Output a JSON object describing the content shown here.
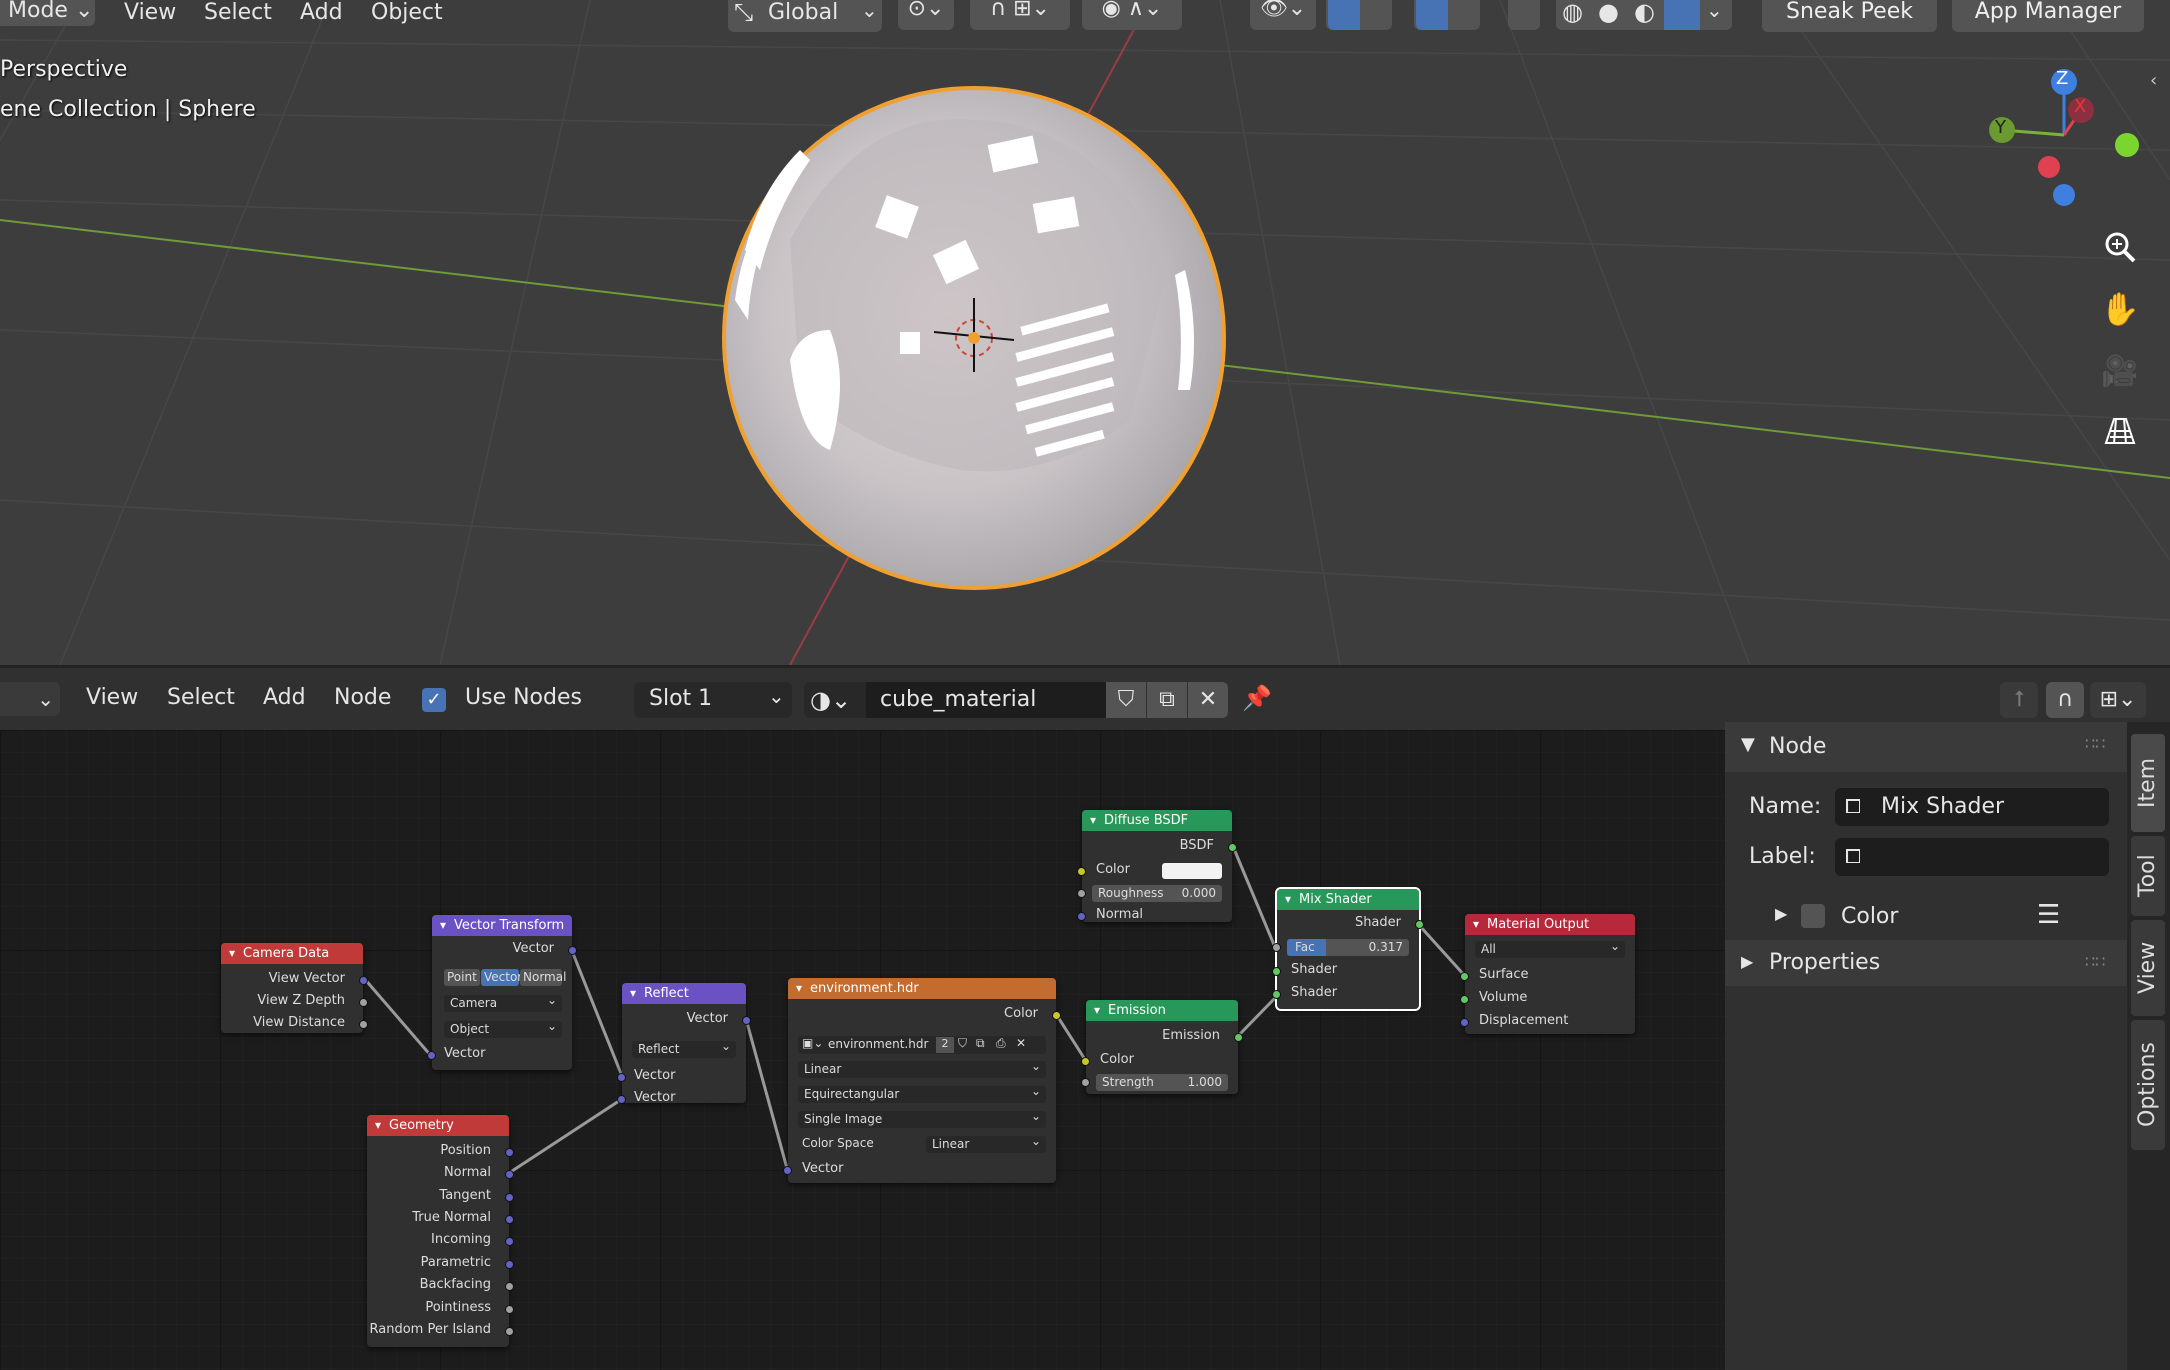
{
  "viewport": {
    "menu": [
      "Mode",
      "View",
      "Select",
      "Add",
      "Object"
    ],
    "transform_orientation": "Global",
    "buttons": [
      "Sneak Peek",
      "App Manager"
    ],
    "overlay_line1": "Perspective",
    "overlay_line2": "ene Collection | Sphere",
    "gizmo": {
      "z": "Z",
      "x": "X",
      "y": "Y"
    }
  },
  "node_editor_header": {
    "menu": [
      "View",
      "Select",
      "Add",
      "Node"
    ],
    "use_nodes_label": "Use Nodes",
    "slot": "Slot 1",
    "material": "cube_material"
  },
  "nodes": {
    "camera_data": {
      "title": "Camera Data",
      "outputs": [
        "View Vector",
        "View Z Depth",
        "View Distance"
      ]
    },
    "vector_transform": {
      "title": "Vector Transform",
      "output": "Vector",
      "modes": [
        "Point",
        "Vector",
        "Normal"
      ],
      "from": "Camera",
      "to": "Object",
      "input": "Vector"
    },
    "reflect": {
      "title": "Reflect",
      "output": "Vector",
      "op": "Reflect",
      "inputs": [
        "Vector",
        "Vector"
      ]
    },
    "geometry": {
      "title": "Geometry",
      "outputs": [
        "Position",
        "Normal",
        "Tangent",
        "True Normal",
        "Incoming",
        "Parametric",
        "Backfacing",
        "Pointiness",
        "Random Per Island"
      ]
    },
    "environment": {
      "title": "environment.hdr",
      "output": "Color",
      "image": "environment.hdr",
      "users": "2",
      "interp": "Linear",
      "projection": "Equirectangular",
      "source": "Single Image",
      "color_space_label": "Color Space",
      "color_space": "Linear",
      "input": "Vector"
    },
    "diffuse": {
      "title": "Diffuse BSDF",
      "output": "BSDF",
      "color_label": "Color",
      "roughness_label": "Roughness",
      "roughness": "0.000",
      "normal_label": "Normal"
    },
    "emission": {
      "title": "Emission",
      "output": "Emission",
      "color_label": "Color",
      "strength_label": "Strength",
      "strength": "1.000"
    },
    "mix": {
      "title": "Mix Shader",
      "output": "Shader",
      "fac_label": "Fac",
      "fac": "0.317",
      "fac_value": 0.317,
      "inputs": [
        "Shader",
        "Shader"
      ]
    },
    "output": {
      "title": "Material Output",
      "target": "All",
      "inputs": [
        "Surface",
        "Volume",
        "Displacement"
      ]
    }
  },
  "sidebar": {
    "panel_node": "Node",
    "name_label": "Name:",
    "name_value": "Mix Shader",
    "label_label": "Label:",
    "label_value": "",
    "color_label": "Color",
    "properties_label": "Properties",
    "tabs": [
      "Item",
      "Tool",
      "View",
      "Options"
    ]
  },
  "colors": {
    "input_header": "#c13a3a",
    "converter_header": "#6b52c4",
    "shader_header": "#279859",
    "texture_header": "#c46b2f",
    "output_header": "#b6293a",
    "selection_outline": "#f0a030",
    "accent": "#4772b3"
  }
}
